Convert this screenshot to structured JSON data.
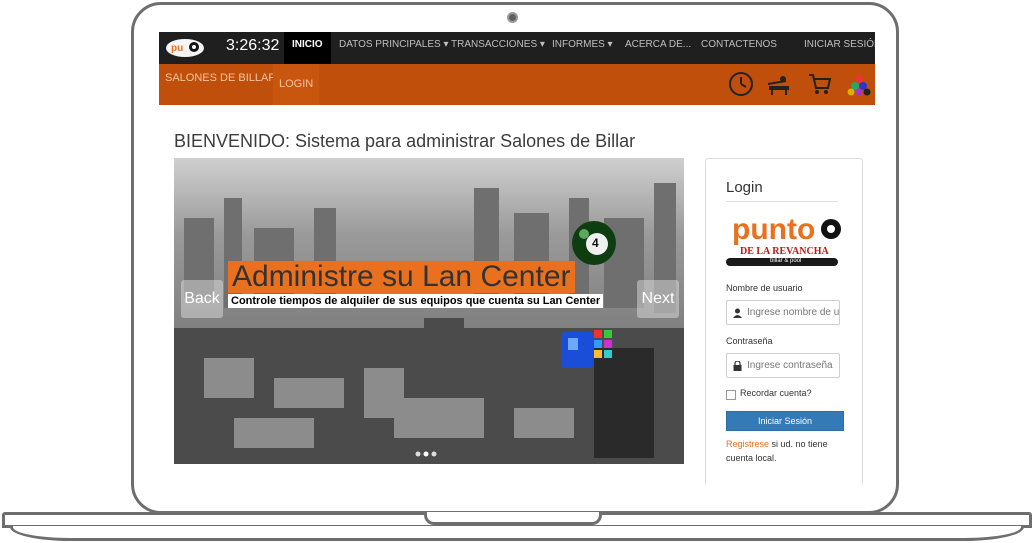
{
  "nav": {
    "clock": "3:26:32",
    "items": [
      "INICIO",
      "DATOS PRINCIPALES ▾",
      "TRANSACCIONES ▾",
      "INFORMES ▾",
      "ACERCA DE...",
      "CONTACTENOS",
      "INICIAR SESIÓN"
    ]
  },
  "subnav": {
    "items": [
      "SALONES DE BILLAR",
      "LOGIN"
    ]
  },
  "page": {
    "heading": "BIENVENIDO: Sistema para administrar Salones de Billar"
  },
  "carousel": {
    "title": "Administre su Lan Center",
    "subtitle": "Controle tiempos de alquiler de sus equipos que cuenta su Lan Center",
    "prev": "Back",
    "next": "Next",
    "ball_number": "4"
  },
  "login": {
    "title": "Login",
    "logo_text": "punto",
    "logo_sub": "DE LA REVANCHA",
    "logo_tag": "billar & pool",
    "user_label": "Nombre de usuario",
    "user_placeholder": "Ingrese nombre de u",
    "pass_label": "Contraseña",
    "pass_placeholder": "Ingrese contraseña",
    "remember": "Recordar cuenta?",
    "submit": "Iniciar Sesión",
    "register_link": "Registrese",
    "register_text": " si ud. no tiene cuenta local."
  },
  "colors": {
    "accent": "#c04f0b",
    "highlight": "#e8701e",
    "button": "#337ab7"
  }
}
